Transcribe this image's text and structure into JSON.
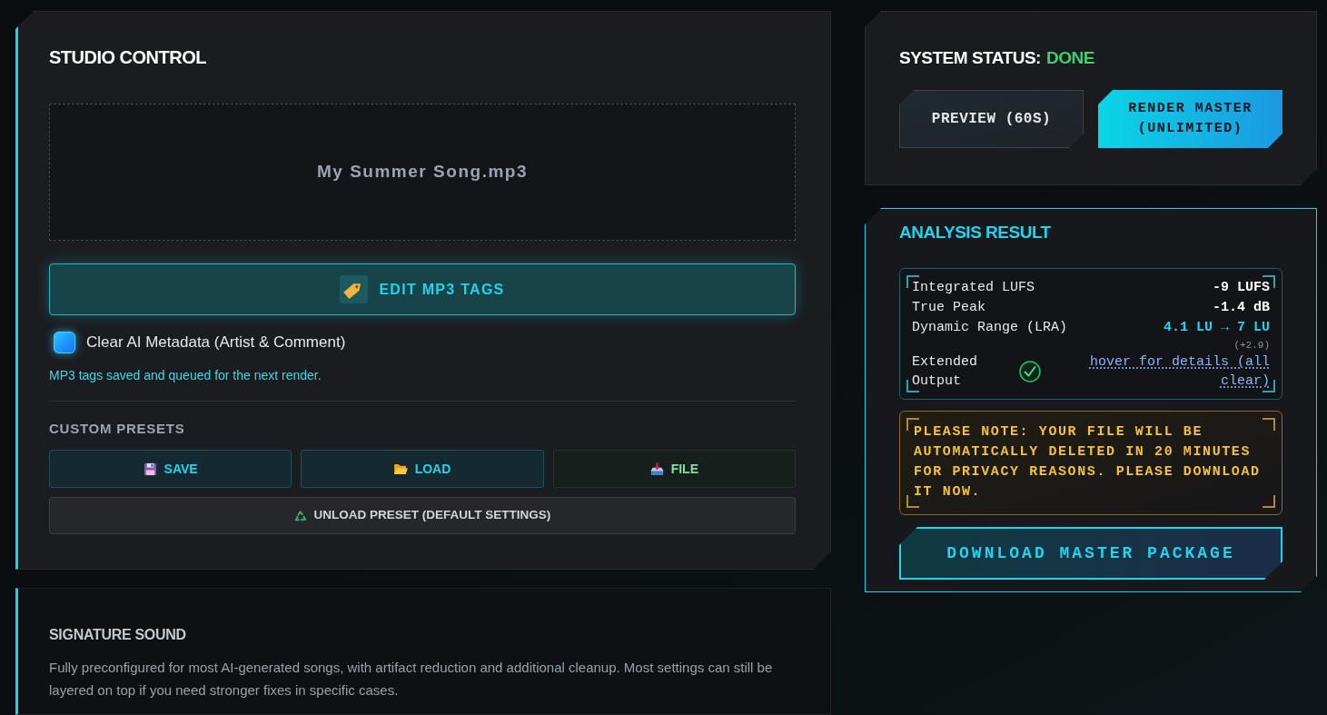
{
  "studio_control": {
    "title": "STUDIO CONTROL",
    "dropzone": {
      "file_name": "My Summer Song.mp3"
    },
    "edit_tags_button": {
      "label": "EDIT MP3 TAGS"
    },
    "clear_metadata": {
      "label": "Clear AI Metadata (Artist & Comment)",
      "checked": true
    },
    "status_message": "MP3 tags saved and queued for the next render.",
    "custom_presets": {
      "heading": "CUSTOM PRESETS",
      "buttons": [
        {
          "label": "SAVE",
          "kind": "save"
        },
        {
          "label": "LOAD",
          "kind": "load"
        },
        {
          "label": "FILE",
          "kind": "file"
        }
      ],
      "unload_button": {
        "label": "UNLOAD PRESET (DEFAULT SETTINGS)"
      }
    }
  },
  "signature_sound": {
    "title": "SIGNATURE SOUND",
    "description": "Fully preconfigured for most AI-generated songs, with artifact reduction and additional cleanup. Most settings can still be layered on top if you need stronger fixes in specific cases."
  },
  "system_status": {
    "label": "SYSTEM STATUS:",
    "value": "DONE",
    "buttons": [
      {
        "label": "PREVIEW (60S)",
        "kind": "secondary"
      },
      {
        "label": "RENDER MASTER (UNLIMITED)",
        "kind": "primary"
      }
    ]
  },
  "analysis_result": {
    "title": "ANALYSIS RESULT",
    "metrics": [
      {
        "kind": "value",
        "label": "Integrated LUFS",
        "value": "-9 LUFS"
      },
      {
        "kind": "value",
        "label": "True Peak",
        "value": "-1.4 dB"
      },
      {
        "kind": "change",
        "label": "Dynamic Range (LRA)",
        "value": "4.1 LU → 7 LU",
        "delta": "(+2.9)"
      },
      {
        "kind": "check",
        "label": "Extended Output",
        "link": "hover for details (all clear)"
      }
    ],
    "notice": "PLEASE NOTE: YOUR FILE WILL BE AUTOMATICALLY DELETED IN 20 MINUTES FOR PRIVACY REASONS. PLEASE DOWNLOAD IT NOW.",
    "download_button": {
      "label": "DOWNLOAD MASTER PACKAGE"
    }
  }
}
